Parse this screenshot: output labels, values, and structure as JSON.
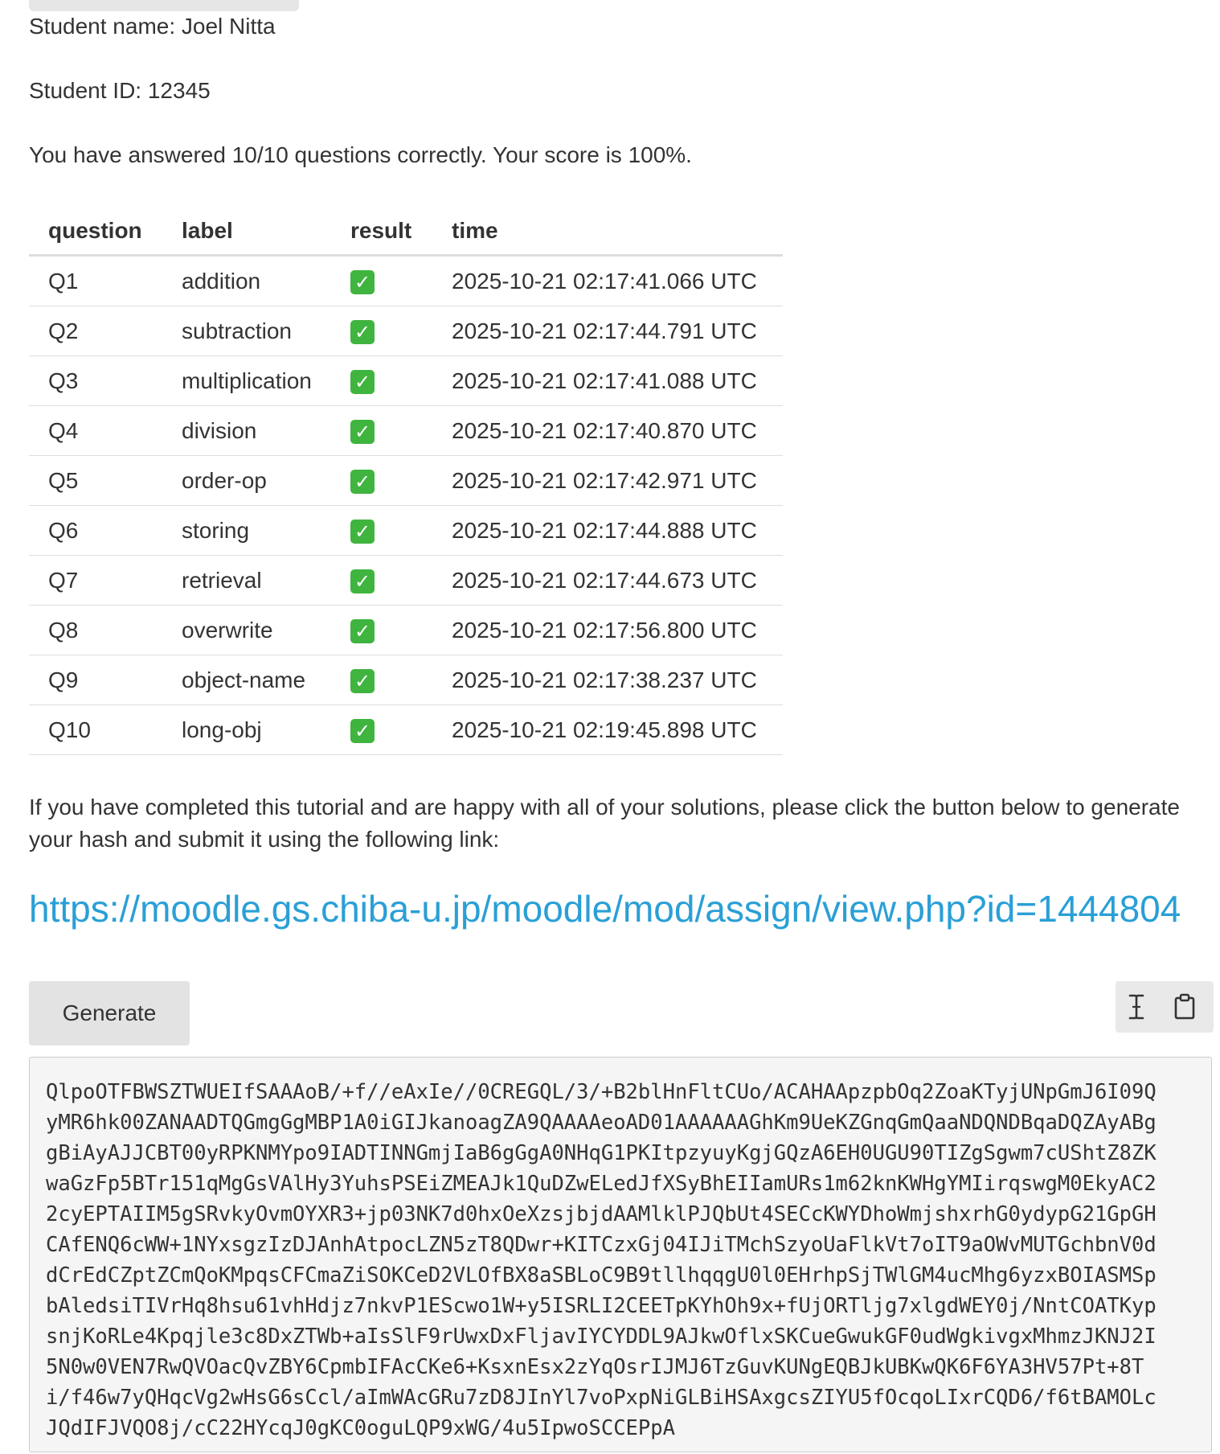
{
  "student": {
    "name_line": "Student name: Joel Nitta",
    "id_line": "Student ID: 12345"
  },
  "score_line": "You have answered 10/10 questions correctly. Your score is 100%.",
  "results_table": {
    "headers": [
      "question",
      "label",
      "result",
      "time"
    ],
    "rows": [
      {
        "question": "Q1",
        "label": "addition",
        "result": "correct",
        "time": "2025-10-21 02:17:41.066 UTC"
      },
      {
        "question": "Q2",
        "label": "subtraction",
        "result": "correct",
        "time": "2025-10-21 02:17:44.791 UTC"
      },
      {
        "question": "Q3",
        "label": "multiplication",
        "result": "correct",
        "time": "2025-10-21 02:17:41.088 UTC"
      },
      {
        "question": "Q4",
        "label": "division",
        "result": "correct",
        "time": "2025-10-21 02:17:40.870 UTC"
      },
      {
        "question": "Q5",
        "label": "order-op",
        "result": "correct",
        "time": "2025-10-21 02:17:42.971 UTC"
      },
      {
        "question": "Q6",
        "label": "storing",
        "result": "correct",
        "time": "2025-10-21 02:17:44.888 UTC"
      },
      {
        "question": "Q7",
        "label": "retrieval",
        "result": "correct",
        "time": "2025-10-21 02:17:44.673 UTC"
      },
      {
        "question": "Q8",
        "label": "overwrite",
        "result": "correct",
        "time": "2025-10-21 02:17:56.800 UTC"
      },
      {
        "question": "Q9",
        "label": "object-name",
        "result": "correct",
        "time": "2025-10-21 02:17:38.237 UTC"
      },
      {
        "question": "Q10",
        "label": "long-obj",
        "result": "correct",
        "time": "2025-10-21 02:19:45.898 UTC"
      }
    ],
    "result_icon": "green-check-icon"
  },
  "instructions": "If you have completed this tutorial and are happy with all of your solutions, please click the button below to generate your hash and submit it using the following link:",
  "submission_link": "https://moodle.gs.chiba-u.jp/moodle/mod/assign/view.php?id=1444804",
  "generate_label": "Generate",
  "hash_toolbar": {
    "select_icon": "text-cursor-icon",
    "copy_icon": "clipboard-icon"
  },
  "hash_lines": [
    "QlpoOTFBWSZTWUEIfSAAAoB/+f//eAxIe//0CREGQL/3/+B2blHnFltCUo/ACAHAApzpbOq2ZoaKTyjUNpGmJ6I09Q",
    "yMR6hk00ZANAADTQGmgGgMBP1A0iGIJkanoagZA9QAAAAeoAD01AAAAAAGhKm9UeKZGnqGmQaaNDQNDBqaDQZAyABg",
    "gBiAyAJJCBT00yRPKNMYpo9IADTINNGmjIaB6gGgA0NHqG1PKItpzyuyKgjGQzA6EH0UGU90TIZgSgwm7cUShtZ8ZK",
    "waGzFp5BTr151qMgGsVAlHy3YuhsPSEiZMEAJk1QuDZwELedJfXSyBhEIIamURs1m62knKWHgYMIirqswgM0EkyAC2",
    "2cyEPTAIIM5gSRvkyOvmOYXR3+jp03NK7d0hxOeXzsjbjdAAMlklPJQbUt4SECcKWYDhoWmjshxrhG0ydypG21GpGH",
    "CAfENQ6cWW+1NYxsgzIzDJAnhAtpocLZN5zT8QDwr+KITCzxGj04IJiTMchSzyoUaFlkVt7oIT9aOWvMUTGchbnV0d",
    "dCrEdCZptZCmQoKMpqsCFCmaZiSOKCeD2VLOfBX8aSBLoC9B9tllhqqgU0l0EHrhpSjTWlGM4ucMhg6yzxBOIASMSp",
    "bAledsiTIVrHq8hsu61vhHdjz7nkvP1EScwo1W+y5ISRLI2CEETpKYhOh9x+fUjORTljg7xlgdWEY0j/NntCOATKyp",
    "snjKoRLe4Kpqjle3c8DxZTWb+aIsSlF9rUwxDxFljavIYCYDDL9AJkwOflxSKCueGwukGF0udWgkivgxMhmzJKNJ2I",
    "5N0w0VEN7RwQVOacQvZBY6CpmbIFAcCKe6+KsxnEsx2zYqOsrIJMJ6TzGuvKUNgEQBJkUBKwQK6F6YA3HV57Pt+8T",
    "i/f46w7yQHqcVg2wHsG6sCcl/aImWAcGRu7zD8JInYl7voPxpNiGLBiHSAxgcsZIYU5fOcqoLIxrCQD6/f6tBAMOLc",
    "JQdIFJVQO8j/cC22HYcqJ0gKC0oguLQP9xWG/4u5IpwoSCCEPpA"
  ]
}
